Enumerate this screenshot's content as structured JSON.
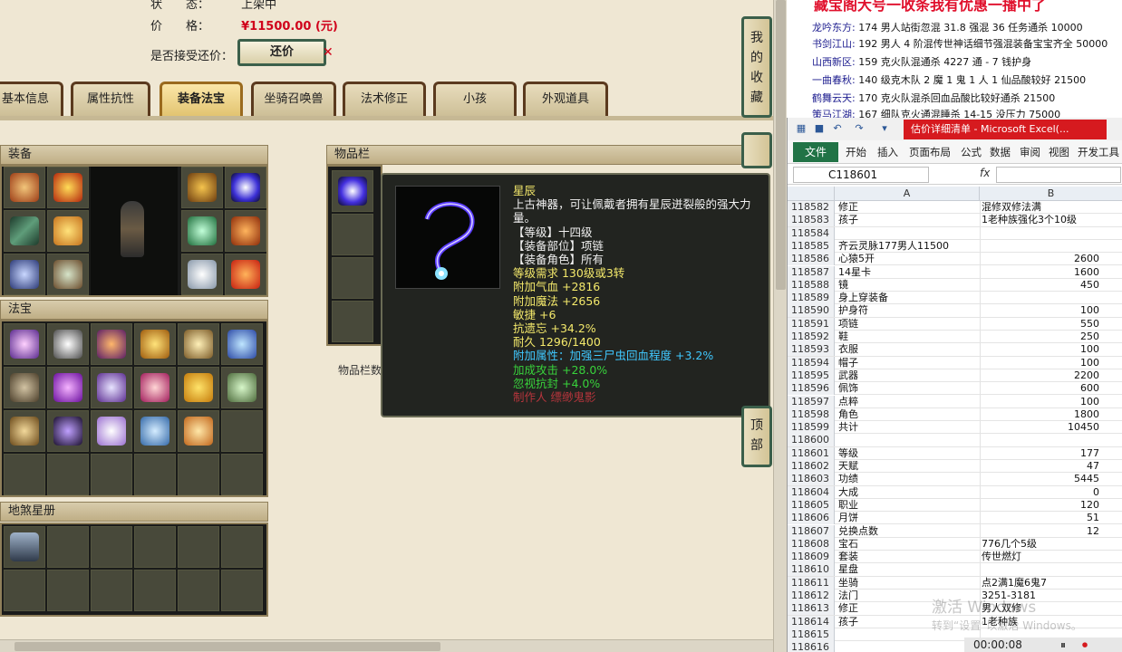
{
  "trade": {
    "status_label": "状　　态：",
    "status_value": "上架中",
    "price_label": "价　　格：",
    "price_value": "¥11500.00 (元)",
    "haggle_label": "是否接受还价：",
    "haggle_button": "还价",
    "haggle_mark": "✕"
  },
  "tabs": [
    {
      "label": "基本信息"
    },
    {
      "label": "属性抗性"
    },
    {
      "label": "装备法宝"
    },
    {
      "label": "坐骑召唤兽"
    },
    {
      "label": "法术修正"
    },
    {
      "label": "小孩"
    },
    {
      "label": "外观道具"
    }
  ],
  "panels": {
    "equip": "装备",
    "fabao": "法宝",
    "disha": "地煞星册",
    "items": "物品栏",
    "items_hint": "物品栏数"
  },
  "side_tabs": {
    "collect": [
      "我",
      "的",
      "收",
      "藏"
    ],
    "top": [
      "顶",
      "部"
    ]
  },
  "tooltip": {
    "name": "星辰",
    "desc": "上古神器，可让佩戴者拥有星辰迸裂般的强大力量。",
    "level": "【等级】十四级",
    "slot": "【装备部位】项链",
    "role": "【装备角色】所有",
    "req": "等级需求 130级或3转",
    "hp": "附加气血 +2816",
    "mp": "附加魔法 +2656",
    "agi": "敏捷 +6",
    "resist": "抗遗忘 +34.2%",
    "durability": "耐久 1296/1400",
    "extra_label": "附加属性：",
    "extra_value": "加强三尸虫回血程度 +3.2%",
    "atk": "加成攻击 +28.0%",
    "seal": "忽视抗封 +4.0%",
    "maker": "制作人 缥缈鬼影"
  },
  "notice": {
    "title": "藏宝阁大号一收条我有优惠一播中了",
    "lines": [
      {
        "name": "龙吟东方:",
        "text": "174 男人站街忽混 31.8 强混 36 任务通杀 10000"
      },
      {
        "name": "书剑江山:",
        "text": "192 男人 4 阶混传世神话细节强混装备宝宝齐全 50000"
      },
      {
        "name": "山西新区:",
        "text": "159 克火队混通杀 4227 通 - 7 钱护身"
      },
      {
        "name": "一曲春秋:",
        "text": "140 级克木队 2 魔 1 鬼 1 人 1 仙品酸较好 21500"
      },
      {
        "name": "鹤舞云天:",
        "text": "170 克火队混杀回血品酸比较好通杀 21500"
      },
      {
        "name": "策马江湖:",
        "text": "167 细队克火通混睡杀 14-15 没压力 75000"
      }
    ]
  },
  "excel": {
    "window_title": "估价详细清单 - Microsoft Excel(...",
    "file_tab": "文件",
    "ribbon_tabs": [
      "开始",
      "插入",
      "页面布局",
      "公式",
      "数据",
      "审阅",
      "视图",
      "开发工具"
    ],
    "name_box": "C118601",
    "fx": "fx",
    "col_a": "A",
    "col_b": "B",
    "rows": [
      {
        "n": "118582",
        "a": "修正",
        "b": "混修双修法满"
      },
      {
        "n": "118583",
        "a": "孩子",
        "b": "1老种族强化3个10级"
      },
      {
        "n": "118584",
        "a": "",
        "b": ""
      },
      {
        "n": "118585",
        "a": "齐云灵脉177男人11500",
        "b": ""
      },
      {
        "n": "118586",
        "a": "心猿5开",
        "b": "2600"
      },
      {
        "n": "118587",
        "a": "14星卡",
        "b": "1600"
      },
      {
        "n": "118588",
        "a": "镜",
        "b": "450"
      },
      {
        "n": "118589",
        "a": "身上穿装备",
        "b": ""
      },
      {
        "n": "118590",
        "a": "护身符",
        "b": "100"
      },
      {
        "n": "118591",
        "a": "项链",
        "b": "550"
      },
      {
        "n": "118592",
        "a": "鞋",
        "b": "250"
      },
      {
        "n": "118593",
        "a": "衣服",
        "b": "100"
      },
      {
        "n": "118594",
        "a": "帽子",
        "b": "100"
      },
      {
        "n": "118595",
        "a": "武器",
        "b": "2200"
      },
      {
        "n": "118596",
        "a": "佩饰",
        "b": "600"
      },
      {
        "n": "118597",
        "a": "点粹",
        "b": "100"
      },
      {
        "n": "118598",
        "a": "角色",
        "b": "1800"
      },
      {
        "n": "118599",
        "a": "共计",
        "b": "10450"
      },
      {
        "n": "118600",
        "a": "",
        "b": ""
      },
      {
        "n": "118601",
        "a": "等级",
        "b": "177"
      },
      {
        "n": "118602",
        "a": "天赋",
        "b": "47"
      },
      {
        "n": "118603",
        "a": "功绩",
        "b": "5445"
      },
      {
        "n": "118604",
        "a": "大成",
        "b": "0"
      },
      {
        "n": "118605",
        "a": "职业",
        "b": "120"
      },
      {
        "n": "118606",
        "a": "月饼",
        "b": "51"
      },
      {
        "n": "118607",
        "a": "兑换点数",
        "b": "12"
      },
      {
        "n": "118608",
        "a": "宝石",
        "b": "776几个5级"
      },
      {
        "n": "118609",
        "a": "套装",
        "b": "传世燃灯"
      },
      {
        "n": "118610",
        "a": "星盘",
        "b": ""
      },
      {
        "n": "118611",
        "a": "坐骑",
        "b": "点2满1魔6鬼7"
      },
      {
        "n": "118612",
        "a": "法门",
        "b": "3251-3181"
      },
      {
        "n": "118613",
        "a": "修正",
        "b": "男人双修"
      },
      {
        "n": "118614",
        "a": "孩子",
        "b": "1老种族"
      },
      {
        "n": "118615",
        "a": "",
        "b": ""
      },
      {
        "n": "118616",
        "a": "",
        "b": ""
      }
    ]
  },
  "overlay": {
    "activate": "激活 Windows",
    "activate_sub": "转到“设置”以激活 Windows。",
    "timer": "00:00:08"
  },
  "colors": {
    "price": "#d0021b",
    "excel_green": "#217346",
    "excel_red_tab": "#d61a1f",
    "tooltip_yellow": "#f4e96b",
    "tooltip_cyan": "#40c8ff",
    "tooltip_green": "#38d23b"
  }
}
